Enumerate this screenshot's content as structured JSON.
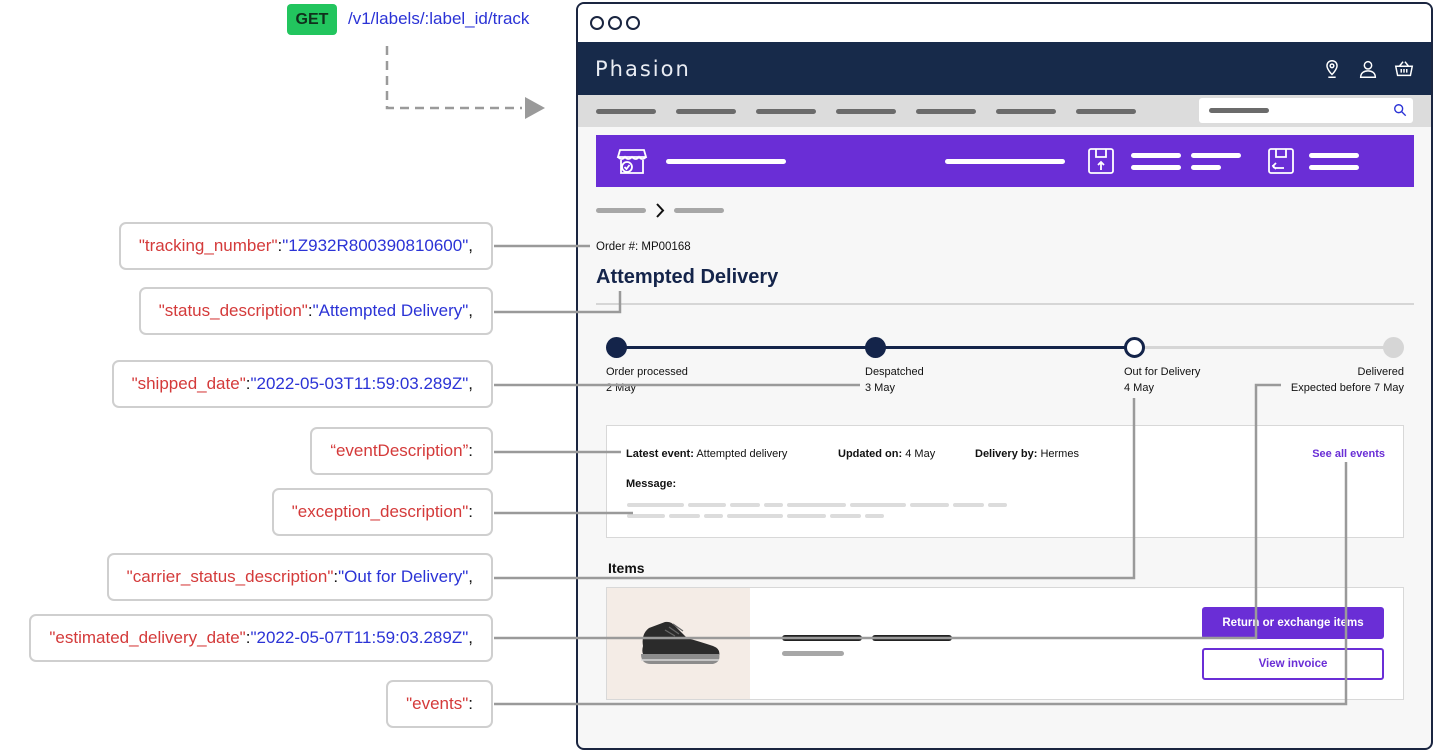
{
  "request": {
    "method": "GET",
    "endpoint": "/v1/labels/:label_id/track"
  },
  "fields": [
    {
      "key": "\"tracking_number\"",
      "sep": ": ",
      "value": "\"1Z932R800390810600\"",
      "end": ","
    },
    {
      "key": "\"status_description\"",
      "sep": ": ",
      "value": "\"Attempted Delivery\"",
      "end": ","
    },
    {
      "key": "\"shipped_date\"",
      "sep": ": ",
      "value": "\"2022-05-03T11:59:03.289Z\"",
      "end": ","
    },
    {
      "key": "“eventDescription”",
      "sep": ":",
      "value": "",
      "end": ""
    },
    {
      "key": "\"exception_description\"",
      "sep": ":",
      "value": "",
      "end": ""
    },
    {
      "key": "\"carrier_status_description\"",
      "sep": ": ",
      "value": "\"Out for Delivery\"",
      "end": ","
    },
    {
      "key": "\"estimated_delivery_date\"",
      "sep": ": ",
      "value": "\"2022-05-07T11:59:03.289Z\"",
      "end": ","
    },
    {
      "key": "\"events\"",
      "sep": ":",
      "value": "",
      "end": ""
    }
  ],
  "app": {
    "brand": "Phasion",
    "order_label": "Order #:",
    "order_number": "MP00168",
    "title": "Attempted Delivery",
    "steps": [
      {
        "name": "Order processed",
        "date": "2 May",
        "state": "done"
      },
      {
        "name": "Despatched",
        "date": "3 May",
        "state": "done"
      },
      {
        "name": "Out for Delivery",
        "date": "4 May",
        "state": "current"
      },
      {
        "name": "Delivered",
        "date": "Expected before 7 May",
        "state": "pending"
      }
    ],
    "event": {
      "latest_label": "Latest event:",
      "latest_value": "Attempted delivery",
      "updated_label": "Updated on:",
      "updated_value": "4 May",
      "delivery_label": "Delivery by:",
      "delivery_value": "Hermes",
      "see_all": "See all events",
      "message_label": "Message:"
    },
    "items_title": "Items",
    "return_button": "Return or exchange items",
    "invoice_button": "View invoice"
  },
  "colors": {
    "header": "#172a4a",
    "accent": "#6a2ed6",
    "key": "#d43a3a",
    "value": "#2b33d6",
    "get_badge": "#22c55e"
  },
  "icons": [
    "location-pin-icon",
    "user-icon",
    "basket-icon",
    "search-icon",
    "store-icon",
    "package-up-icon",
    "package-return-icon",
    "chevron-right-icon",
    "shoe-image",
    "arrow-right-icon"
  ]
}
